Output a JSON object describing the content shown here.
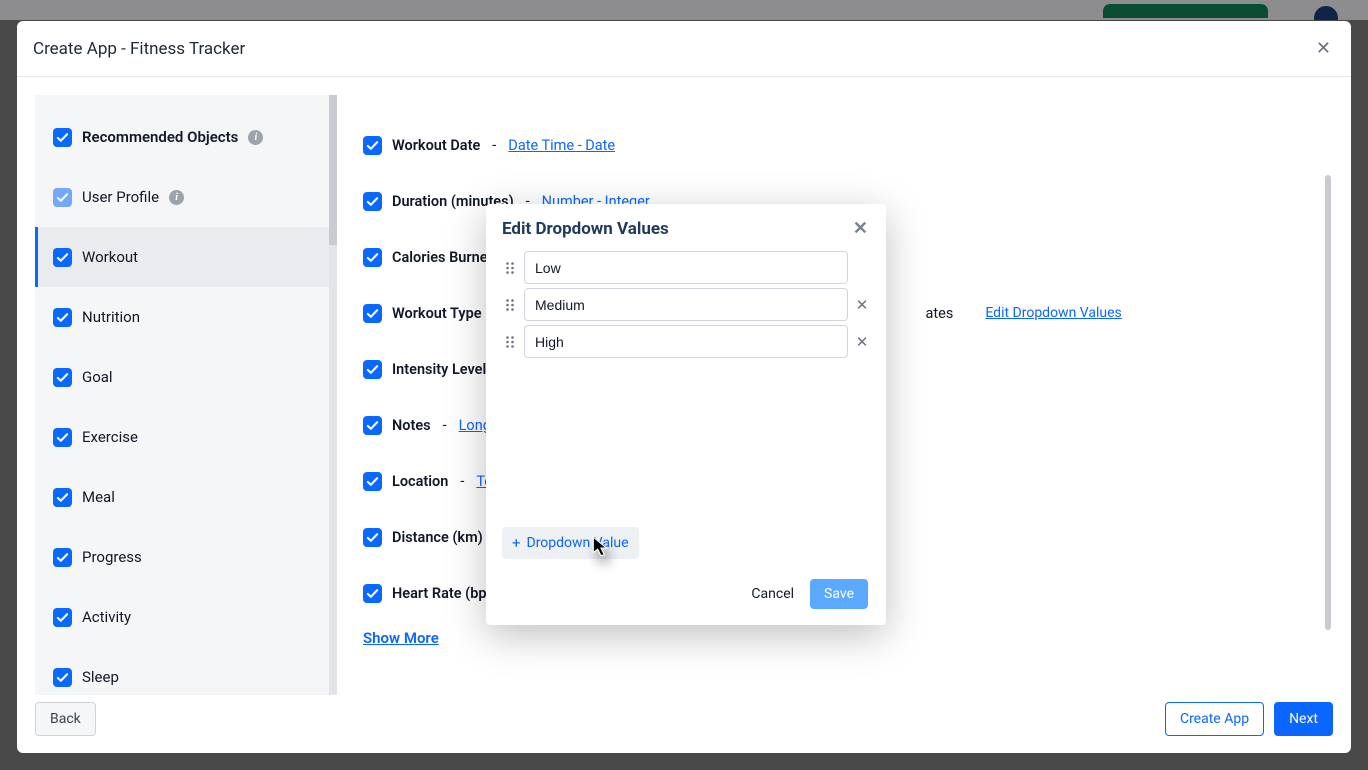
{
  "modal": {
    "title": "Create App - Fitness Tracker",
    "back": "Back",
    "create_app": "Create App",
    "next": "Next"
  },
  "sidebar": {
    "items": [
      {
        "label": "Recommended Objects",
        "header": true,
        "info": true
      },
      {
        "label": "User Profile",
        "muted": true,
        "info": true
      },
      {
        "label": "Workout",
        "selected": true
      },
      {
        "label": "Nutrition"
      },
      {
        "label": "Goal"
      },
      {
        "label": "Exercise"
      },
      {
        "label": "Meal"
      },
      {
        "label": "Progress"
      },
      {
        "label": "Activity"
      },
      {
        "label": "Sleep"
      }
    ]
  },
  "fields": {
    "rows": [
      {
        "name": "Workout Date",
        "type": "Date Time - Date"
      },
      {
        "name": "Duration (minutes)",
        "type": "Number - Integer"
      },
      {
        "name": "Calories Burned",
        "type": ""
      },
      {
        "name": "Workout Type",
        "type": "",
        "tail": "ates",
        "edit": "Edit Dropdown Values"
      },
      {
        "name": "Intensity Level",
        "type": ""
      },
      {
        "name": "Notes",
        "type": "Long Te"
      },
      {
        "name": "Location",
        "type": "Text"
      },
      {
        "name": "Distance (km)",
        "type": ""
      },
      {
        "name": "Heart Rate (bpm",
        "type": ""
      }
    ],
    "show_more": "Show More"
  },
  "popup": {
    "title": "Edit Dropdown Values",
    "values": [
      "Low",
      "Medium",
      "High"
    ],
    "add_label": "Dropdown Value",
    "cancel": "Cancel",
    "save": "Save"
  }
}
